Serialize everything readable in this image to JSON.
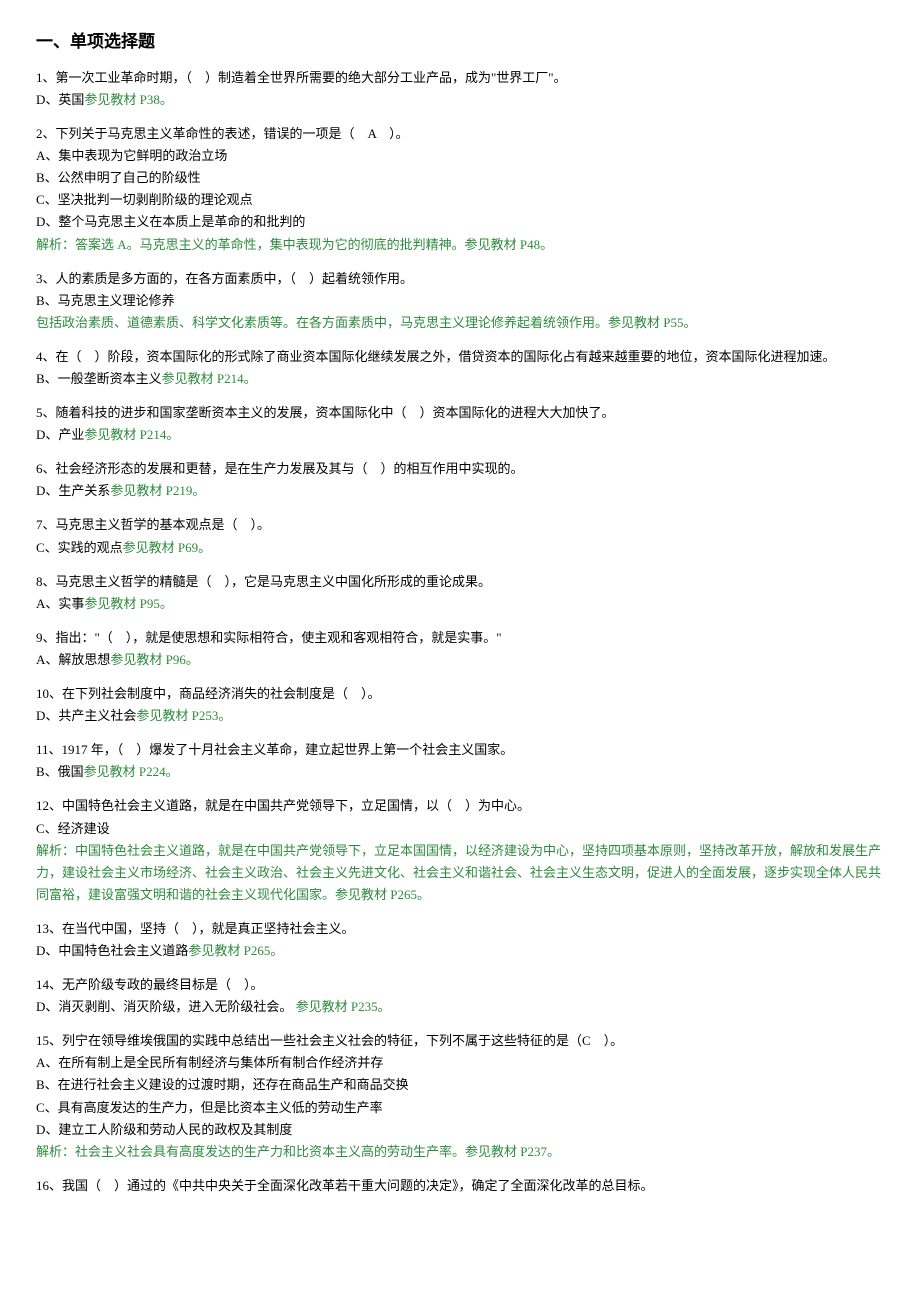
{
  "title": "一、单项选择题",
  "questions": [
    {
      "q": "1、第一次工业革命时期，（　）制造着全世界所需要的绝大部分工业产品，成为\"世界工厂\"。",
      "ans": "D、英国",
      "ref": "参见教材 P38。"
    },
    {
      "q": "2、下列关于马克思主义革命性的表述，错误的一项是（　A　）。",
      "opts": [
        "A、集中表现为它鲜明的政治立场",
        "B、公然申明了自己的阶级性",
        "C、坚决批判一切剥削阶级的理论观点",
        "D、整个马克思主义在本质上是革命的和批判的"
      ],
      "analysis": "解析：答案选 A。马克思主义的革命性，集中表现为它的彻底的批判精神。参见教材 P48。"
    },
    {
      "q": "3、人的素质是多方面的，在各方面素质中，（　）起着统领作用。",
      "ans": "B、马克思主义理论修养",
      "analysis_plain": "包括政治素质、道德素质、科学文化素质等。在各方面素质中，马克思主义理论修养起着统领作用。参见教材 P55。"
    },
    {
      "q": "4、在（　）阶段，资本国际化的形式除了商业资本国际化继续发展之外，借贷资本的国际化占有越来越重要的地位，资本国际化进程加速。",
      "ans": "B、一般垄断资本主义",
      "ref": "参见教材 P214。"
    },
    {
      "q": "5、随着科技的进步和国家垄断资本主义的发展，资本国际化中（　）资本国际化的进程大大加快了。",
      "ans": "D、产业",
      "ref": "参见教材 P214。"
    },
    {
      "q": "6、社会经济形态的发展和更替，是在生产力发展及其与（　）的相互作用中实现的。",
      "ans": "D、生产关系",
      "ref": "参见教材 P219。"
    },
    {
      "q": "7、马克思主义哲学的基本观点是（　）。",
      "ans": "C、实践的观点",
      "ref": "参见教材 P69。"
    },
    {
      "q": "8、马克思主义哲学的精髓是（　），它是马克思主义中国化所形成的重论成果。",
      "ans": "A、实事",
      "ref": "参见教材 P95。"
    },
    {
      "q": "9、指出：\"（　），就是使思想和实际相符合，使主观和客观相符合，就是实事。\"",
      "ans": "A、解放思想",
      "ref": "参见教材 P96。"
    },
    {
      "q": "10、在下列社会制度中，商品经济消失的社会制度是（　）。",
      "ans": "D、共产主义社会",
      "ref": "参见教材 P253。"
    },
    {
      "q": "11、1917 年，（　）爆发了十月社会主义革命，建立起世界上第一个社会主义国家。",
      "ans": "B、俄国",
      "ref": "参见教材 P224。"
    },
    {
      "q": "12、中国特色社会主义道路，就是在中国共产党领导下，立足国情，以（　）为中心。",
      "ans": "C、经济建设",
      "analysis": "解析：中国特色社会主义道路，就是在中国共产党领导下，立足本国国情，以经济建设为中心，坚持四项基本原则，坚持改革开放，解放和发展生产力，建设社会主义市场经济、社会主义政治、社会主义先进文化、社会主义和谐社会、社会主义生态文明，促进人的全面发展，逐步实现全体人民共同富裕，建设富强文明和谐的社会主义现代化国家。参见教材 P265。"
    },
    {
      "q": "13、在当代中国，坚持（　），就是真正坚持社会主义。",
      "ans": "D、中国特色社会主义道路",
      "ref": "参见教材 P265。"
    },
    {
      "q": "14、无产阶级专政的最终目标是（　）。",
      "ans": "D、消灭剥削、消灭阶级，进入无阶级社会。",
      "ref_nosep": "参见教材 P235。"
    },
    {
      "q": "15、列宁在领导维埃俄国的实践中总结出一些社会主义社会的特征，下列不属于这些特征的是（C　）。",
      "opts": [
        "A、在所有制上是全民所有制经济与集体所有制合作经济并存",
        "B、在进行社会主义建设的过渡时期，还存在商品生产和商品交换",
        "C、具有高度发达的生产力，但是比资本主义低的劳动生产率",
        "D、建立工人阶级和劳动人民的政权及其制度"
      ],
      "analysis": "解析：社会主义社会具有高度发达的生产力和比资本主义高的劳动生产率。参见教材 P237。"
    },
    {
      "q": "16、我国（　）通过的《中共中央关于全面深化改革若干重大问题的决定》，确定了全面深化改革的总目标。"
    }
  ]
}
